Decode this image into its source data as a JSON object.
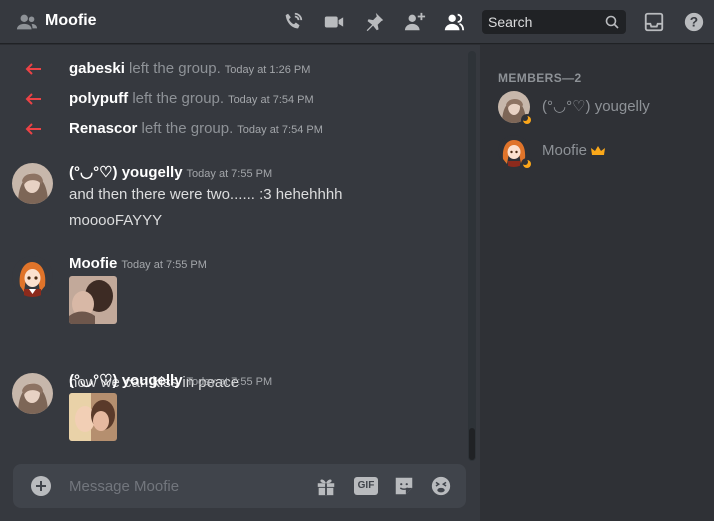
{
  "header": {
    "title": "Moofie",
    "icons": [
      "group-icon",
      "call-icon",
      "video-icon",
      "pin-icon",
      "add-friend-icon",
      "member-list-icon",
      "inbox-icon",
      "help-icon"
    ],
    "search_placeholder": "Search"
  },
  "system_messages": [
    {
      "name": "gabeski",
      "action": "left the group.",
      "time": "Today at 1:26 PM"
    },
    {
      "name": "polypuff",
      "action": "left the group.",
      "time": "Today at 7:54 PM"
    },
    {
      "name": "Renascor",
      "action": "left the group.",
      "time": "Today at 7:54 PM"
    }
  ],
  "messages": [
    {
      "author": "(°◡°♡) yougelly",
      "time": "Today at 7:55 PM",
      "lines": [
        "and then there were two...... :3 hehehhhh",
        "mooooFAYYY"
      ]
    },
    {
      "author": "Moofie",
      "time": "Today at 7:55 PM",
      "lines": [
        "now we can kiss in peace"
      ]
    },
    {
      "author": "(°◡°♡) yougelly",
      "time": "Today at 7:55 PM",
      "lines": []
    }
  ],
  "composer": {
    "placeholder": "Message Moofie",
    "gif_label": "GIF"
  },
  "members": {
    "header": "MEMBERS—2",
    "list": [
      {
        "name": "(°◡°♡) yougelly",
        "status": "idle"
      },
      {
        "name": "Moofie",
        "status": "idle",
        "owner": true
      }
    ]
  },
  "colors": {
    "background": "#36393f",
    "sidebar": "#2f3136",
    "composer": "#40444b",
    "leave_arrow": "#ed4245",
    "idle": "#faa61a",
    "crown": "#faa81a"
  }
}
